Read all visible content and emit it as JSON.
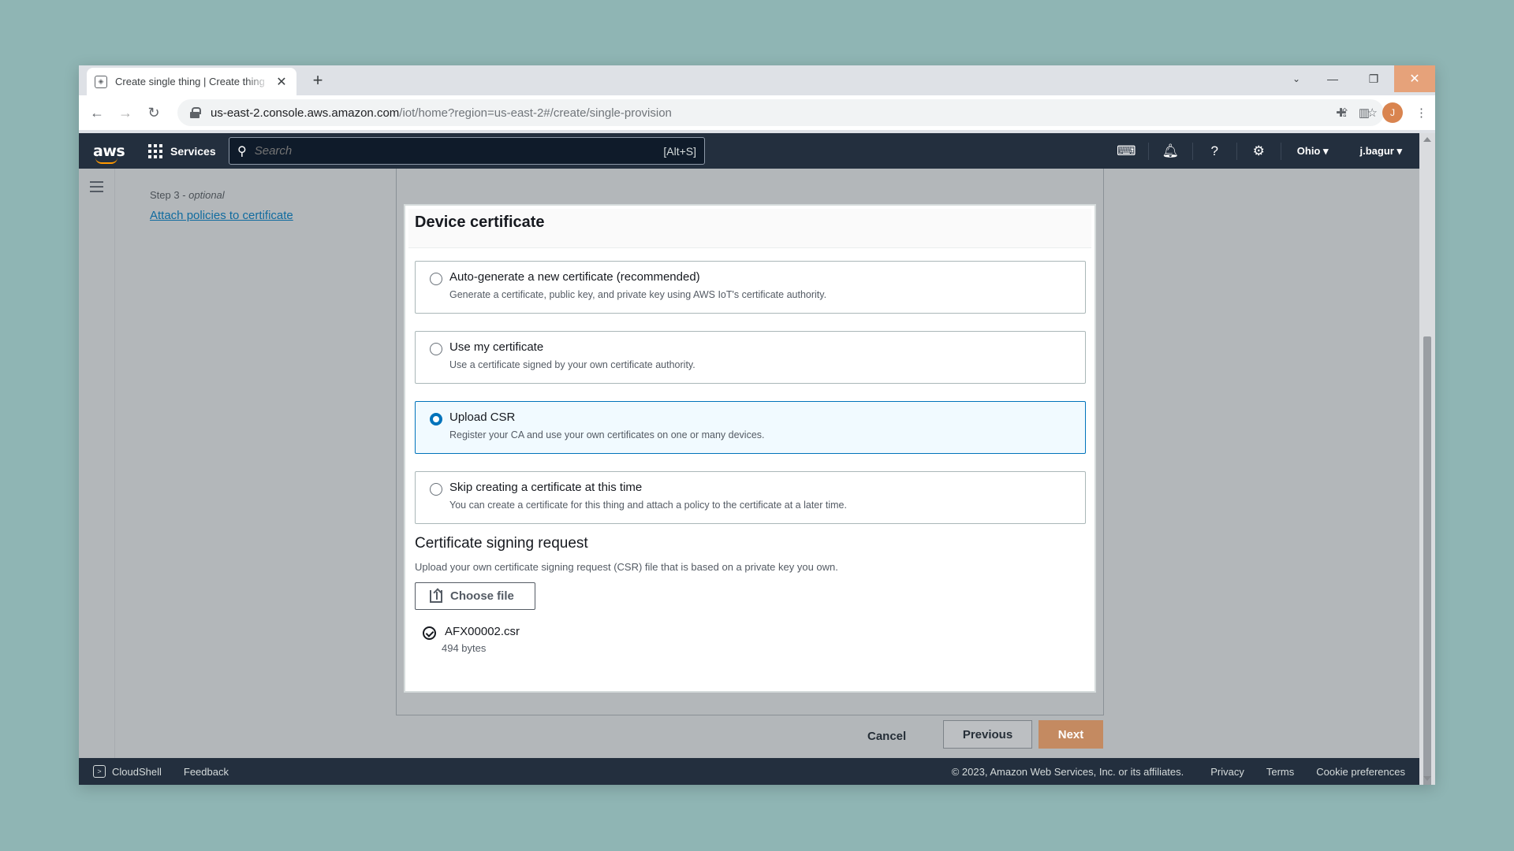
{
  "browser": {
    "tab_title": "Create single thing | Create thing",
    "tab_close": "✕",
    "new_tab": "+",
    "url_host": "us-east-2.console.aws.amazon.com",
    "url_path": "/iot/home?region=us-east-2#/create/single-provision",
    "avatar_letter": "J"
  },
  "aws_nav": {
    "logo": "aws",
    "services_label": "Services",
    "search_placeholder": "Search",
    "search_shortcut": "[Alt+S]",
    "region": "Ohio ▾",
    "user": "j.bagur ▾"
  },
  "side_nav": {
    "step_prefix": "Step 3 - ",
    "step_optional": "optional",
    "step_link": "Attach policies to certificate"
  },
  "card": {
    "title": "Device certificate",
    "options": [
      {
        "title": "Auto-generate a new certificate (recommended)",
        "desc": "Generate a certificate, public key, and private key using AWS IoT's certificate authority.",
        "selected": false
      },
      {
        "title": "Use my certificate",
        "desc": "Use a certificate signed by your own certificate authority.",
        "selected": false
      },
      {
        "title": "Upload CSR",
        "desc": "Register your CA and use your own certificates on one or many devices.",
        "selected": true
      },
      {
        "title": "Skip creating a certificate at this time",
        "desc": "You can create a certificate for this thing and attach a policy to the certificate at a later time.",
        "selected": false
      }
    ],
    "csr_title": "Certificate signing request",
    "csr_desc": "Upload your own certificate signing request (CSR) file that is based on a private key you own.",
    "choose_file": "Choose file",
    "file_name": "AFX00002.csr",
    "file_size": "494 bytes"
  },
  "actions": {
    "cancel": "Cancel",
    "previous": "Previous",
    "next": "Next"
  },
  "footer": {
    "cloudshell": "CloudShell",
    "feedback": "Feedback",
    "copyright": "© 2023, Amazon Web Services, Inc. or its affiliates.",
    "privacy": "Privacy",
    "terms": "Terms",
    "cookies": "Cookie preferences"
  },
  "colors": {
    "accent": "#0073bb",
    "next_button": "#c48a61",
    "nav_bg": "#232f3e"
  }
}
